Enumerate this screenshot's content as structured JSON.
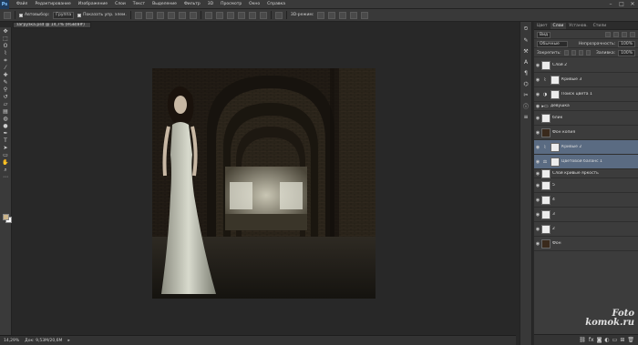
{
  "app": {
    "logo": "Ps"
  },
  "menu": [
    "Файл",
    "Редактирование",
    "Изображение",
    "Слои",
    "Текст",
    "Выделение",
    "Фильтр",
    "3D",
    "Просмотр",
    "Окно",
    "Справка"
  ],
  "window_controls": [
    "–",
    "□",
    "✕"
  ],
  "options": {
    "autoselect_label": "Автовыбор:",
    "autoselect_value": "Группа",
    "transform_label": "Показать упр. элем.",
    "mode_3d_label": "3D-режим:"
  },
  "document_tab": "загрузка.psd @ 14,7% (RGB/8#)",
  "status": {
    "zoom": "14,29%",
    "doc": "Док: 9,53M/20,6M"
  },
  "panel": {
    "tabs": [
      "Цвет",
      "Слои",
      "Установ.",
      "Стили"
    ],
    "kind_label": "Вид",
    "blend_mode": "Обычные",
    "opacity_label": "Непрозрачность:",
    "opacity_value": "100%",
    "lock_label": "Закрепить:",
    "fill_label": "Заливка:",
    "fill_value": "100%"
  },
  "layers": [
    {
      "name": "Слой 2",
      "kind": "pixel",
      "selected": false
    },
    {
      "name": "Кривые 3",
      "kind": "curves",
      "selected": false
    },
    {
      "name": "Поиск цвета 1",
      "kind": "adjust",
      "selected": false
    },
    {
      "name": "девушка",
      "kind": "group",
      "selected": false
    },
    {
      "name": "блик",
      "kind": "pixel",
      "selected": false
    },
    {
      "name": "Фон копия",
      "kind": "photo",
      "selected": false
    },
    {
      "name": "Кривые 2",
      "kind": "curves",
      "selected": true
    },
    {
      "name": "Цветовой баланс 1",
      "kind": "balance",
      "selected": true
    },
    {
      "name": "Слой кривые яркость",
      "kind": "pixel",
      "selected": false
    },
    {
      "name": "5",
      "kind": "pixel",
      "selected": false
    },
    {
      "name": "4",
      "kind": "pixel",
      "selected": false
    },
    {
      "name": "3",
      "kind": "pixel",
      "selected": false
    },
    {
      "name": "2",
      "kind": "pixel",
      "selected": false
    },
    {
      "name": "Фон",
      "kind": "photo",
      "selected": false
    }
  ],
  "watermark": {
    "line1": "Foto",
    "line2": "komok.ru"
  },
  "colors": {
    "accent": "#5a6b82",
    "background": "#282828",
    "foreground_swatch": "#cbb48a"
  }
}
